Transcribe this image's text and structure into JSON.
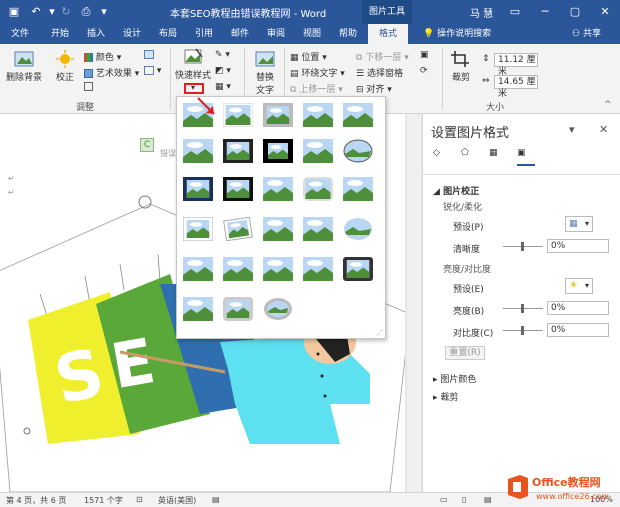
{
  "titlebar": {
    "title": "本套SEO教程由错误教程网 - Word",
    "tools_label": "图片工具",
    "user": "马 慧",
    "minimize": "─",
    "restore": "▢",
    "close": "✕"
  },
  "tabs": [
    "文件",
    "开始",
    "插入",
    "设计",
    "布局",
    "引用",
    "邮件",
    "审阅",
    "视图",
    "帮助",
    "格式"
  ],
  "active_tab": "格式",
  "tellme": "操作说明搜索",
  "share": "共享",
  "ribbon": {
    "remove_bg": "删除背景",
    "correct": "校正",
    "color": "颜色",
    "artistic": "艺术效果",
    "adjust_group": "调整",
    "quick_styles": "快速样式",
    "replace_text_1": "替换",
    "replace_text_2": "文字",
    "position": "位置",
    "wrap_text": "环绕文字",
    "bring_forward": "上移一层",
    "send_backward": "下移一层",
    "selection_pane": "选择窗格",
    "align": "对齐",
    "crop": "裁剪",
    "height": "11.12 厘米",
    "width": "14.65 厘米",
    "size_group": "大小"
  },
  "doc": {
    "alt_text_hint": "错误"
  },
  "pane": {
    "title": "设置图片格式",
    "section_correction": "图片校正",
    "sharpen_soften": "锐化/柔化",
    "preset_1": "预设(P)",
    "sharpness": "清晰度",
    "sharpness_value": "0%",
    "brightness_contrast": "亮度/对比度",
    "preset_2": "预设(E)",
    "brightness": "亮度(B)",
    "brightness_value": "0%",
    "contrast": "对比度(C)",
    "contrast_value": "0%",
    "reset": "重置(R)",
    "section_color": "图片颜色",
    "section_crop": "裁剪"
  },
  "status": {
    "page": "第 4 页，共 6 页",
    "words": "1571 个字",
    "lang": "英语(美国)",
    "zoom": "100%"
  },
  "watermark": {
    "line1": "Office教程网",
    "line2": "www.office26.com"
  },
  "colors": {
    "word_blue": "#2b579a",
    "accent_red": "#e02020",
    "seo_yellow": "#f0ef2e",
    "seo_green": "#5aa83a",
    "seo_blue": "#2f6fb0",
    "cyan_figure": "#5de0f0"
  }
}
